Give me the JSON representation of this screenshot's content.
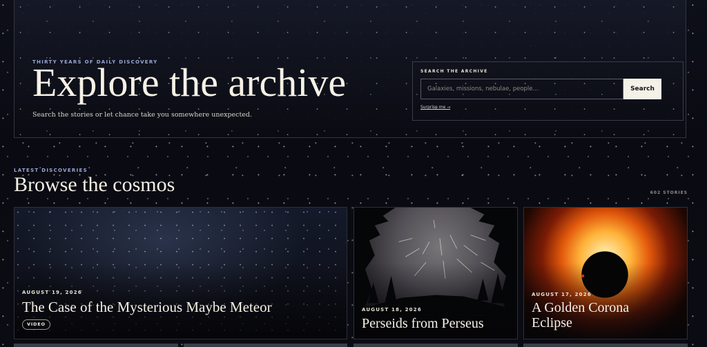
{
  "hero": {
    "eyebrow": "THIRTY YEARS OF DAILY DISCOVERY",
    "title": "Explore the archive",
    "subtitle": "Search the stories or let chance take you somewhere unexpected.",
    "search": {
      "label": "SEARCH THE ARCHIVE",
      "placeholder": "Galaxies, missions, nebulae, people...",
      "value": "",
      "button_label": "Search",
      "surprise_label": "Surprise me →"
    }
  },
  "section": {
    "eyebrow": "LATEST DISCOVERIES",
    "title": "Browse the cosmos",
    "count": "602 STORIES"
  },
  "cards": [
    {
      "date": "AUGUST 19, 2026",
      "title": "The Case of the Mysterious Maybe Meteor",
      "badge": "VIDEO",
      "image": "milky-way-night-sky"
    },
    {
      "date": "AUGUST 18, 2026",
      "title": "Perseids from Perseus",
      "image": "meteor-shower-through-trees"
    },
    {
      "date": "AUGUST 17, 2026",
      "title": "A Golden Corona Eclipse",
      "image": "total-solar-eclipse-corona"
    }
  ],
  "colors": {
    "background": "#0a0b12",
    "eyebrow_accent": "#9aa6d6",
    "text": "#f3efe6",
    "button_bg": "#f4f1e8"
  }
}
